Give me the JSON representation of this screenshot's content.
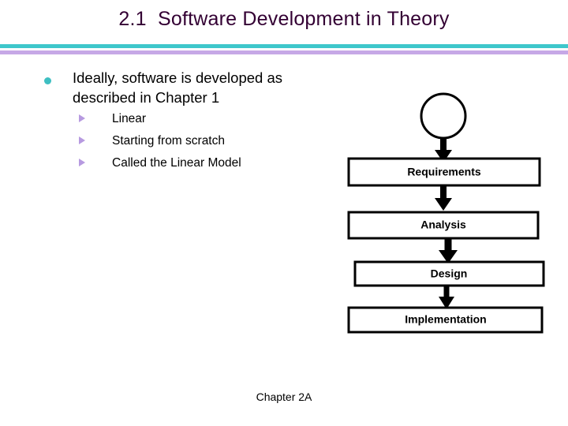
{
  "slide": {
    "title": "2.1  Software Development in Theory",
    "title_color": "#330033",
    "footer": "Chapter 2A"
  },
  "dividers": {
    "teal_color": "#3ec7cb",
    "lavender_color": "#c6a8e6"
  },
  "content": {
    "bullet_color": "#3ebfc2",
    "sub_bullet_color": "#b79ae0",
    "level1": {
      "line1": "Ideally, software is developed as",
      "line2": "described in Chapter 1"
    },
    "level2": [
      {
        "label": "Linear"
      },
      {
        "label": "Starting from scratch"
      },
      {
        "label": "Called the Linear Model"
      }
    ]
  },
  "flowchart": {
    "type": "flow-diagram",
    "start_node": {
      "shape": "circle",
      "label": ""
    },
    "steps": [
      {
        "label": "Requirements"
      },
      {
        "label": "Analysis"
      },
      {
        "label": "Design"
      },
      {
        "label": "Implementation"
      }
    ],
    "connector": "down-arrow",
    "stroke_color": "#000000",
    "fill_color": "#ffffff"
  }
}
